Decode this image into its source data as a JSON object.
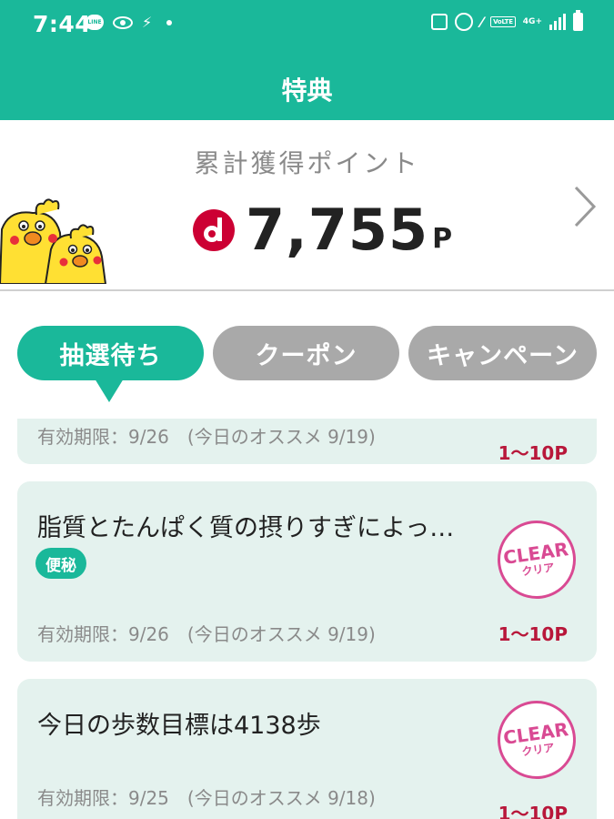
{
  "status_bar": {
    "time": "7:44",
    "left_icons": [
      "line-icon",
      "eye-icon",
      "run-icon",
      "dot-icon"
    ],
    "right_icons": [
      "sim-icon",
      "alarm-icon",
      "mute-icon",
      "volte-icon",
      "network-icon",
      "signal-icon",
      "battery-icon"
    ],
    "line_label": "LINE",
    "volte_label": "VoLTE",
    "network_label": "4G+"
  },
  "header": {
    "title": "特典"
  },
  "points": {
    "label": "累計獲得ポイント",
    "value": "7,755",
    "unit": "P"
  },
  "tabs": [
    {
      "label": "抽選待ち",
      "active": true
    },
    {
      "label": "クーポン",
      "active": false
    },
    {
      "label": "キャンペーン",
      "active": false
    }
  ],
  "cards": [
    {
      "title": "",
      "tag": "",
      "expiry": "有効期限：9/26　(今日のオススメ 9/19)",
      "points": "1〜10P",
      "cleared": false
    },
    {
      "title": "脂質とたんぱく質の摂りすぎによっ…",
      "tag": "便秘",
      "expiry": "有効期限：9/26　(今日のオススメ 9/19)",
      "points": "1〜10P",
      "cleared": true
    },
    {
      "title": "今日の歩数目標は4138歩",
      "tag": "",
      "expiry": "有効期限：9/25　(今日のオススメ 9/18)",
      "points": "1〜10P",
      "cleared": true
    }
  ],
  "clear_badge": {
    "en": "CLEAR",
    "ja": "クリア"
  },
  "colors": {
    "brand": "#1ab89a",
    "card_bg": "#e4f2ee",
    "points_red": "#b8173a",
    "clear_pink": "#d94a93",
    "tab_inactive": "#a9a9a9"
  }
}
